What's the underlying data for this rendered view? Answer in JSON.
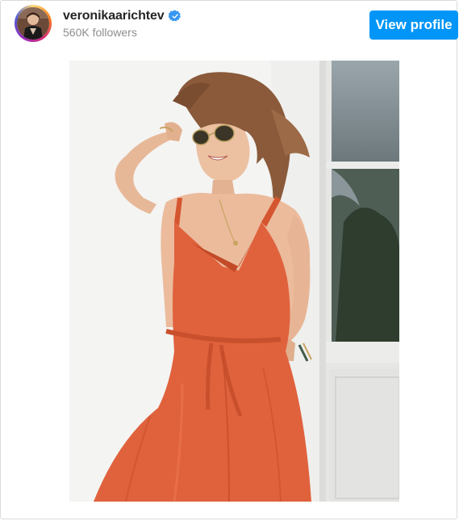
{
  "profile": {
    "username": "veronikaarichtev",
    "followers_text": "560K followers",
    "verified_icon": "verified-badge-icon",
    "avatar_icon": "avatar-image",
    "accent_color": "#0095f6"
  },
  "actions": {
    "view_profile_label": "View profile"
  },
  "post": {
    "media_icon": "post-photo",
    "dress_color": "#e0623d"
  }
}
